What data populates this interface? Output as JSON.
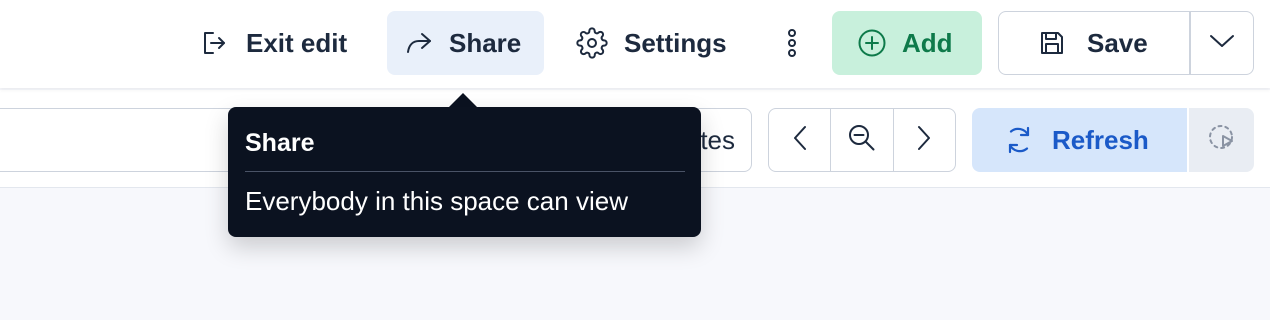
{
  "header": {
    "exit_edit_label": "Exit edit",
    "share_label": "Share",
    "settings_label": "Settings",
    "add_label": "Add",
    "save_label": "Save",
    "icons": [
      "exit-icon",
      "share-arrow-icon",
      "gear-icon",
      "more-vertical-icon",
      "plus-circle-icon",
      "floppy-disk-icon",
      "chevron-down-icon"
    ]
  },
  "toolbar": {
    "date_picker_partial_text": "tes",
    "refresh_label": "Refresh",
    "icons": [
      "chevron-left-icon",
      "zoom-out-icon",
      "chevron-right-icon",
      "refresh-icon",
      "auto-refresh-icon"
    ]
  },
  "tooltip": {
    "title": "Share",
    "body": "Everybody in this space can view"
  },
  "colors": {
    "add_bg": "#c8f0dc",
    "add_text": "#0e7a4a",
    "share_bg": "#e9f0fa",
    "refresh_bg": "#d6e6fb",
    "refresh_text": "#1b5ac8",
    "tooltip_bg": "#0b1220"
  }
}
